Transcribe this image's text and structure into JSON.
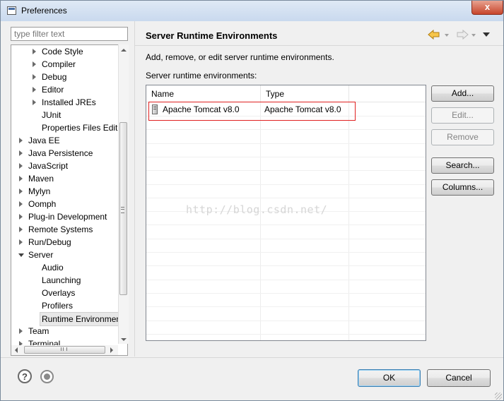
{
  "window": {
    "title": "Preferences",
    "close_label": "x"
  },
  "filter": {
    "placeholder": "type filter text"
  },
  "tree": {
    "items": [
      {
        "label": "Code Style",
        "level": 2,
        "arrow": "closed"
      },
      {
        "label": "Compiler",
        "level": 2,
        "arrow": "closed"
      },
      {
        "label": "Debug",
        "level": 2,
        "arrow": "closed"
      },
      {
        "label": "Editor",
        "level": 2,
        "arrow": "closed"
      },
      {
        "label": "Installed JREs",
        "level": 2,
        "arrow": "closed"
      },
      {
        "label": "JUnit",
        "level": 2,
        "arrow": "none"
      },
      {
        "label": "Properties Files Editor",
        "level": 2,
        "arrow": "none"
      },
      {
        "label": "Java EE",
        "level": 1,
        "arrow": "closed"
      },
      {
        "label": "Java Persistence",
        "level": 1,
        "arrow": "closed"
      },
      {
        "label": "JavaScript",
        "level": 1,
        "arrow": "closed"
      },
      {
        "label": "Maven",
        "level": 1,
        "arrow": "closed"
      },
      {
        "label": "Mylyn",
        "level": 1,
        "arrow": "closed"
      },
      {
        "label": "Oomph",
        "level": 1,
        "arrow": "closed"
      },
      {
        "label": "Plug-in Development",
        "level": 1,
        "arrow": "closed"
      },
      {
        "label": "Remote Systems",
        "level": 1,
        "arrow": "closed"
      },
      {
        "label": "Run/Debug",
        "level": 1,
        "arrow": "closed"
      },
      {
        "label": "Server",
        "level": 1,
        "arrow": "open"
      },
      {
        "label": "Audio",
        "level": 2,
        "arrow": "none"
      },
      {
        "label": "Launching",
        "level": 2,
        "arrow": "none"
      },
      {
        "label": "Overlays",
        "level": 2,
        "arrow": "none"
      },
      {
        "label": "Profilers",
        "level": 2,
        "arrow": "none"
      },
      {
        "label": "Runtime Environments",
        "level": 2,
        "arrow": "none",
        "selected": true
      },
      {
        "label": "Team",
        "level": 1,
        "arrow": "closed"
      },
      {
        "label": "Terminal",
        "level": 1,
        "arrow": "closed"
      }
    ]
  },
  "page": {
    "title": "Server Runtime Environments",
    "description": "Add, remove, or edit server runtime environments.",
    "list_label": "Server runtime environments:"
  },
  "table": {
    "columns": [
      "Name",
      "Type"
    ],
    "rows": [
      {
        "name": "Apache Tomcat v8.0",
        "type": "Apache Tomcat v8.0"
      }
    ]
  },
  "buttons": {
    "add": "Add...",
    "edit": "Edit...",
    "remove": "Remove",
    "search": "Search...",
    "columns": "Columns...",
    "ok": "OK",
    "cancel": "Cancel"
  },
  "watermark": "http://blog.csdn.net/",
  "icons": {
    "back": "back-arrow-icon",
    "forward": "forward-arrow-icon",
    "view_menu": "view-menu-icon",
    "help": "help-icon",
    "import": "import-export-icon"
  },
  "colors": {
    "highlight_box": "#e02020",
    "back_arrow": "#e8a317"
  }
}
